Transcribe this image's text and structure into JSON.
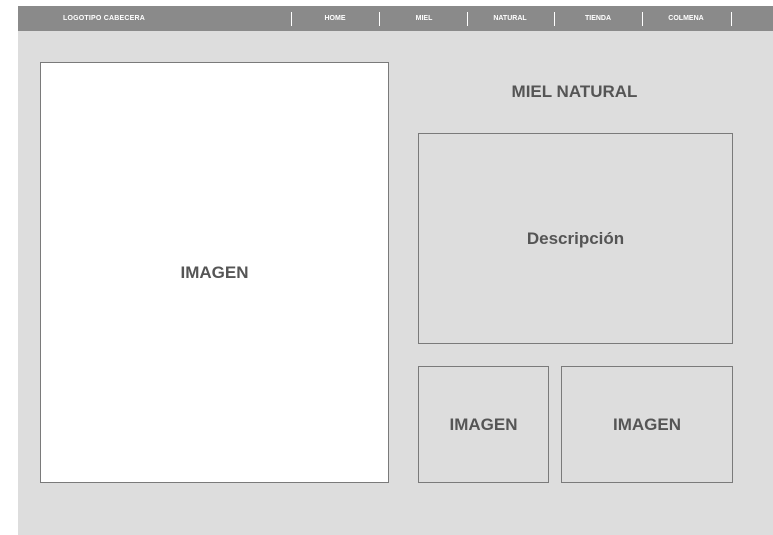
{
  "header": {
    "logo": "LOGOTIPO CABECERA",
    "nav": [
      "HOME",
      "MIEL",
      "NATURAL",
      "TIENDA",
      "COLMENA"
    ]
  },
  "main": {
    "hero_image_label": "IMAGEN",
    "title": "MIEL NATURAL",
    "description_label": "Descripción",
    "thumb1_label": "IMAGEN",
    "thumb2_label": "IMAGEN"
  },
  "colors": {
    "topbar": "#8a8a8a",
    "page_background": "#dddddd",
    "placeholder_text": "#555555"
  }
}
